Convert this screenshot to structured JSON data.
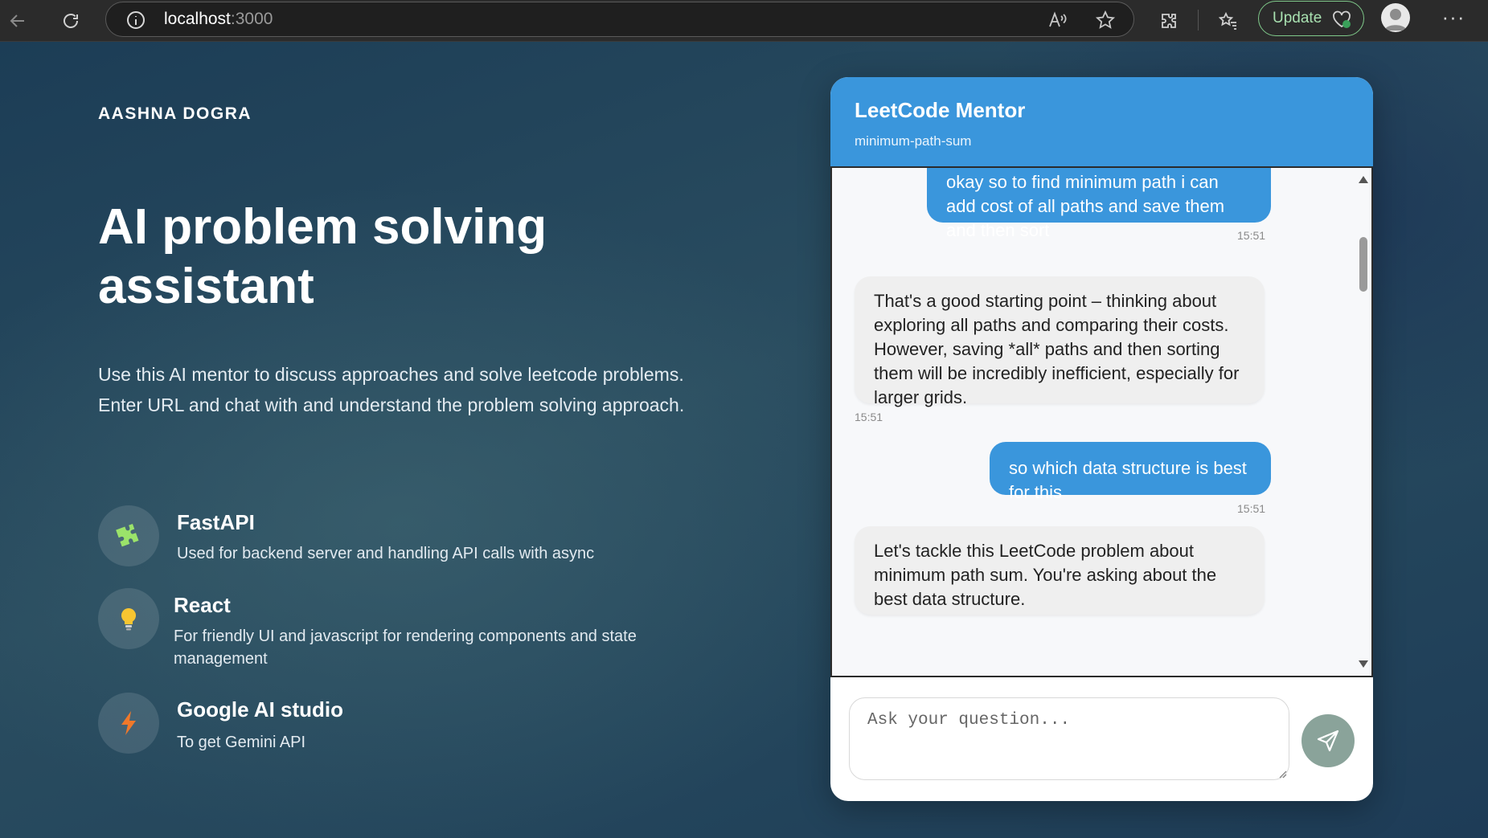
{
  "browser": {
    "url_host": "localhost",
    "url_port": ":3000",
    "update_label": "Update"
  },
  "hero": {
    "brand": "AASHNA DOGRA",
    "title": "AI problem solving assistant",
    "description": "Use this AI mentor to discuss approaches and solve leetcode problems. Enter URL and chat with and understand the problem solving approach."
  },
  "features": [
    {
      "title": "FastAPI",
      "description": "Used for backend server and handling API calls with async",
      "icon": "puzzle-icon",
      "color": "#9be36a"
    },
    {
      "title": "React",
      "description": "For friendly UI and javascript for rendering components and state management",
      "icon": "lightbulb-icon",
      "color": "#f7c531"
    },
    {
      "title": "Google AI studio",
      "description": "To get Gemini API",
      "icon": "lightning-icon",
      "color": "#f0782a"
    }
  ],
  "chat": {
    "title": "LeetCode Mentor",
    "subtitle": "minimum-path-sum",
    "messages": [
      {
        "role": "user",
        "text": "okay so to find minimum path i can add cost of all paths and save them and then sort",
        "time": "15:51"
      },
      {
        "role": "bot",
        "text": "That's a good starting point – thinking about exploring all paths and comparing their costs. However, saving *all* paths and then sorting them will be incredibly inefficient, especially for larger grids.",
        "time": "15:51"
      },
      {
        "role": "user",
        "text": "so which data structure is best for this",
        "time": "15:51"
      },
      {
        "role": "bot",
        "text": "Let's tackle this LeetCode problem about minimum path sum. You're asking about the best data structure.",
        "time": ""
      }
    ],
    "input_placeholder": "Ask your question..."
  },
  "colors": {
    "accent": "#3a96dc",
    "send_button": "#8aa39a"
  }
}
